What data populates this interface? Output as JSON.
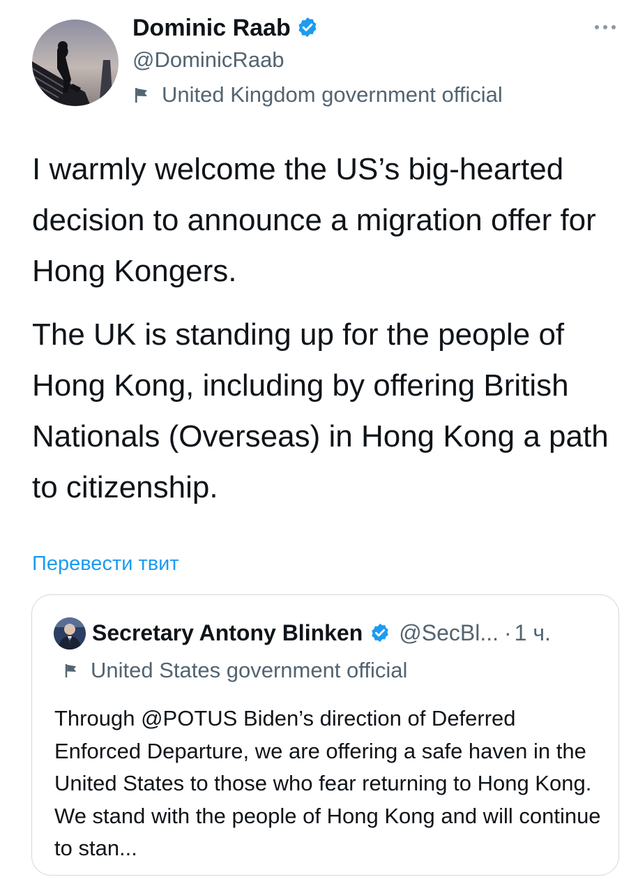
{
  "tweet": {
    "author": {
      "name": "Dominic Raab",
      "handle": "@DominicRaab",
      "label": "United Kingdom government official"
    },
    "paragraphs": [
      "I warmly welcome the US’s big-hearted decision to announce a migration offer for Hong Kongers.",
      "The UK is standing up for the people of Hong Kong, including by offering British Nationals (Overseas) in Hong Kong a path to citizenship."
    ],
    "translate_label": "Перевести твит"
  },
  "quoted_tweet": {
    "name": "Secretary Antony Blinken",
    "handle": "@SecBl...",
    "separator": "·",
    "time": "1 ч.",
    "label": "United States government official",
    "text": "Through @POTUS Biden’s direction of Deferred Enforced Departure, we are offering a safe haven in the United States to those who fear returning to Hong Kong. We stand with the people of Hong Kong and will continue to stan..."
  },
  "icons": {
    "verified": "verified-badge-icon",
    "more": "more-options-icon",
    "flag": "government-flag-icon"
  },
  "colors": {
    "verified": "#1d9bf0",
    "link": "#1d9bf0",
    "secondary_text": "#536471",
    "border": "#cfd9de"
  }
}
